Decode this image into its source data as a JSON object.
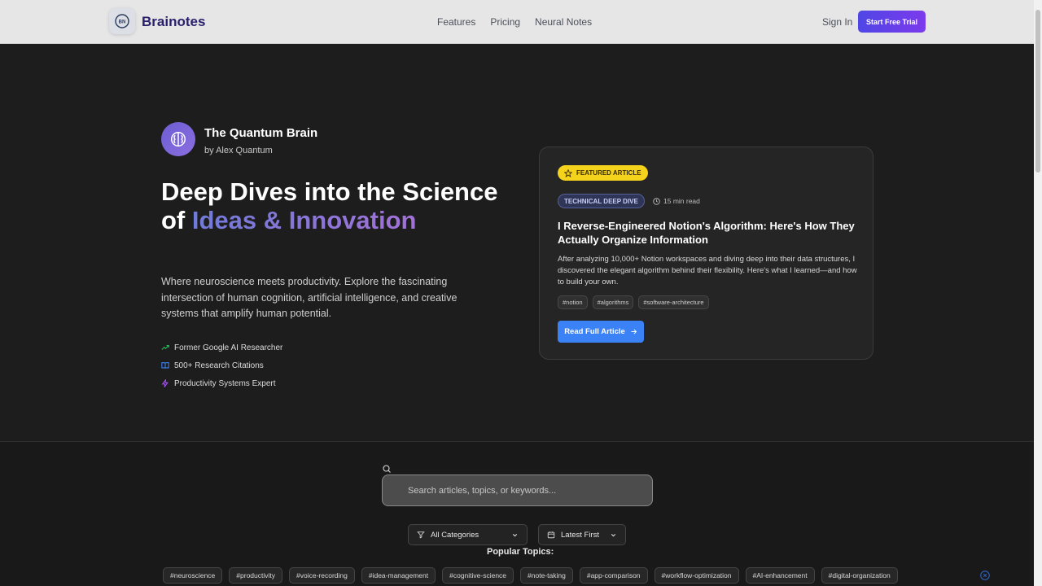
{
  "header": {
    "logo_initials": "BN",
    "brand": "Brainotes",
    "nav": [
      "Features",
      "Pricing",
      "Neural Notes"
    ],
    "sign_in": "Sign In",
    "cta": "Start Free Trial"
  },
  "hero": {
    "author_name": "The Quantum Brain",
    "author_byline": "by Alex Quantum",
    "title_part1": "Deep Dives into the Science of ",
    "title_highlight": "Ideas & Innovation",
    "description": "Where neuroscience meets productivity. Explore the fascinating intersection of human cognition, artificial intelligence, and creative systems that amplify human potential.",
    "credentials": [
      {
        "icon": "trending-up-icon",
        "text": "Former Google AI Researcher",
        "color": "#22c55e"
      },
      {
        "icon": "book-open-icon",
        "text": "500+ Research Citations",
        "color": "#3b82f6"
      },
      {
        "icon": "zap-icon",
        "text": "Productivity Systems Expert",
        "color": "#a855f7"
      }
    ]
  },
  "featured": {
    "badge": "FEATURED ARTICLE",
    "category": "TECHNICAL DEEP DIVE",
    "read_time": "15 min read",
    "title": "I Reverse-Engineered Notion's Algorithm: Here's How They Actually Organize Information",
    "description": "After analyzing 10,000+ Notion workspaces and diving deep into their data structures, I discovered the elegant algorithm behind their flexibility. Here's what I learned—and how to build your own.",
    "tags": [
      "#notion",
      "#algorithms",
      "#software-architecture"
    ],
    "button": "Read Full Article"
  },
  "search": {
    "placeholder": "Search articles, topics, or keywords..."
  },
  "filters": {
    "category": "All Categories",
    "sort": "Latest First"
  },
  "popular": {
    "label": "Popular Topics:",
    "topics": [
      "#neuroscience",
      "#productivity",
      "#voice-recording",
      "#idea-management",
      "#cognitive-science",
      "#note-taking",
      "#app-comparison",
      "#workflow-optimization",
      "#AI-enhancement",
      "#digital-organization"
    ]
  },
  "colors": {
    "accent": "#3b82f6",
    "brand_gradient_start": "#4f46e5",
    "brand_gradient_end": "#7c3aed",
    "featured_badge": "#f5d31c"
  }
}
